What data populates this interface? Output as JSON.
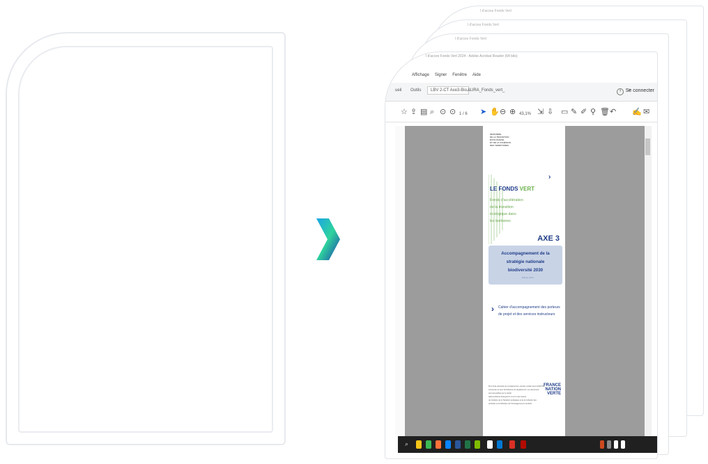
{
  "left_panel": {
    "label": ""
  },
  "stack_titles": [
    "l d'acces Fonds Vert",
    "l d'acces Fonds Vert",
    "l d'acces Fonds Vert"
  ],
  "window": {
    "title": "l d'acces Fonds Vert 2024 - Adobe Acrobat Reader (64 bits)",
    "menu": [
      "Affichage",
      "Signer",
      "Fenêtre",
      "Aide"
    ],
    "tabs": {
      "home": "ueil",
      "tools": "Outils",
      "document": "LBV 2-CT Axe3-Bio...",
      "other": "AURA_Fonds_vert_"
    },
    "help_icon": "?",
    "bell_icon": "bell-icon",
    "signin": "Se connecter",
    "page_indicator": "1 / 6",
    "zoom": "43,1%"
  },
  "document": {
    "ministry": "MINISTÈRE\nDE LA TRANSITION\nÉCOLOGIQUE\nET DE LA COHÉSION\nDES TERRITOIRES",
    "title_part1": "LE FONDS ",
    "title_part2": "VERT",
    "subtitle": "Fonds d'accélération\nde la transition\nécologique dans\nles territoires",
    "axe": "AXE 3",
    "axe_text": "Accompagnement de la stratégie nationale biodiversité 2030",
    "axe_year": "Édition 2024",
    "cahier": "Cahier d'accompagnement des porteurs\nde projet et des services instructeurs",
    "footnote": "Pour toute demande de renseignement, prendre contact avec la DDT(M)\nconcernée ou avec la Préfecture de département. Les documents\nsont accessibles sur le portail\naides-territoires.beta.gouv.fr et sur le site internet\ndu ministère de la Transition écologique et de la Cohésion des\nterritoires et du Ministère de l'Aménagement du territoire",
    "france_nation": "FRANCE\nNATION\nVERTE"
  }
}
